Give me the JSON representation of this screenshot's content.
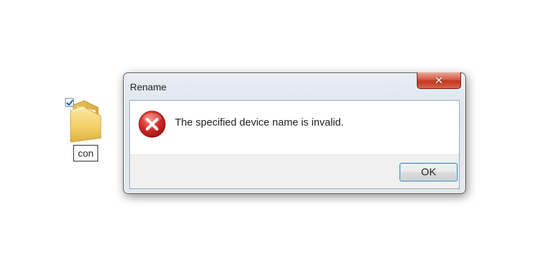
{
  "desktop": {
    "folder": {
      "icon": "folder-icon",
      "checked": true,
      "rename_value": "con"
    }
  },
  "dialog": {
    "title": "Rename",
    "close_icon": "close-icon",
    "error_icon": "error-icon",
    "message": "The specified device name is invalid.",
    "ok_label": "OK"
  },
  "colors": {
    "close_button": "#c9422a",
    "error_red": "#d42a2a",
    "ok_border": "#3c7fb1",
    "folder_yellow": "#f2d06b"
  }
}
